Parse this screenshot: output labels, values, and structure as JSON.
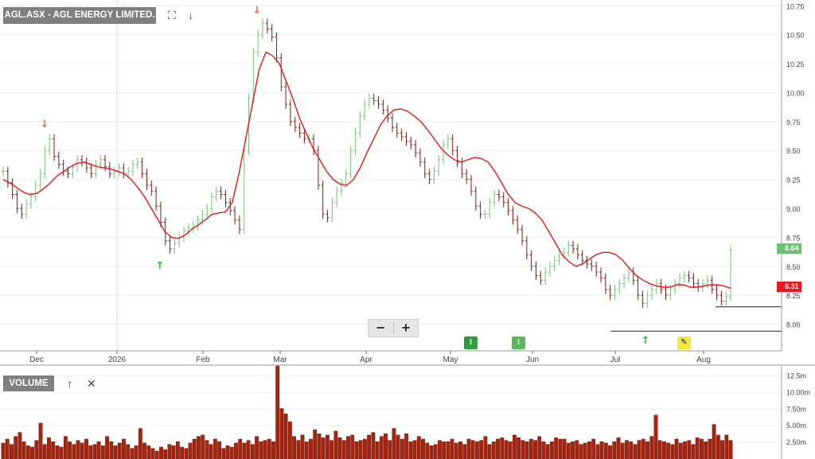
{
  "chart_title": "AGL.ASX - AGL ENERGY LIMITED.",
  "volume_label": "VOLUME",
  "icons": {
    "fullscreen": "fullscreen-icon",
    "download": "arrow-down-icon",
    "volume_up": "arrow-up-icon",
    "volume_close": "close-icon",
    "zoom_out": "minus-icon",
    "zoom_in": "plus-icon",
    "drawing": "pencil-icon"
  },
  "zoom": {
    "minus": "−",
    "plus": "+"
  },
  "event_markers": [
    {
      "label": "I",
      "color": "#2e9e3a"
    },
    {
      "label": "I",
      "color": "#5cb85c"
    }
  ],
  "price_tags": {
    "last": {
      "label": "8.64",
      "color": "#6fbf73"
    },
    "ma": {
      "label": "8.31",
      "color": "#e8191c"
    }
  },
  "colors": {
    "up_bar": "#7fbf7f",
    "down_bar": "#7a1e1e",
    "ma_line": "#e8191c",
    "volume_bar": "#a8240e",
    "signal_up": "#23c323",
    "signal_down": "#e07070"
  },
  "chart_data": [
    {
      "type": "line",
      "subtype": "ohlc-with-moving-average",
      "x_ticks": [
        "Dec",
        "2026",
        "Feb",
        "Mar",
        "Apr",
        "May",
        "Jun",
        "Jul",
        "Aug"
      ],
      "y_ticks": [
        "10.75",
        "10.50",
        "10.25",
        "10.00",
        "9.75",
        "9.50",
        "9.25",
        "9.00",
        "8.75",
        "8.50",
        "8.25",
        "8.00"
      ],
      "ylim": [
        7.77,
        10.8
      ],
      "support_lines": [
        7.94,
        8.15
      ],
      "grid": true,
      "close_series": [
        9.32,
        9.22,
        9.12,
        9.0,
        8.95,
        9.04,
        9.1,
        9.2,
        9.3,
        9.5,
        9.6,
        9.45,
        9.38,
        9.32,
        9.3,
        9.35,
        9.42,
        9.4,
        9.35,
        9.3,
        9.38,
        9.42,
        9.36,
        9.3,
        9.32,
        9.35,
        9.3,
        9.32,
        9.38,
        9.4,
        9.3,
        9.2,
        9.15,
        9.02,
        8.88,
        8.72,
        8.65,
        8.7,
        8.75,
        8.8,
        8.83,
        8.85,
        8.9,
        8.95,
        9.0,
        9.1,
        9.15,
        9.12,
        9.05,
        8.98,
        8.9,
        8.82,
        9.5,
        9.95,
        10.35,
        10.5,
        10.6,
        10.55,
        10.48,
        10.3,
        10.05,
        9.9,
        9.75,
        9.7,
        9.65,
        9.6,
        9.6,
        9.5,
        9.2,
        8.95,
        8.92,
        9.05,
        9.15,
        9.22,
        9.3,
        9.5,
        9.65,
        9.8,
        9.9,
        9.95,
        9.93,
        9.9,
        9.85,
        9.78,
        9.7,
        9.65,
        9.62,
        9.58,
        9.55,
        9.48,
        9.4,
        9.3,
        9.25,
        9.32,
        9.42,
        9.55,
        9.6,
        9.5,
        9.4,
        9.3,
        9.25,
        9.15,
        9.02,
        8.95,
        8.95,
        9.05,
        9.12,
        9.1,
        9.05,
        8.98,
        8.9,
        8.82,
        8.72,
        8.6,
        8.5,
        8.42,
        8.38,
        8.45,
        8.5,
        8.55,
        8.6,
        8.62,
        8.68,
        8.65,
        8.6,
        8.55,
        8.52,
        8.5,
        8.45,
        8.4,
        8.3,
        8.25,
        8.3,
        8.35,
        8.4,
        8.45,
        8.38,
        8.25,
        8.18,
        8.25,
        8.3,
        8.35,
        8.3,
        8.25,
        8.3,
        8.35,
        8.4,
        8.42,
        8.4,
        8.35,
        8.32,
        8.35,
        8.38,
        8.3,
        8.25,
        8.2,
        8.24,
        8.64
      ],
      "ma_series": [
        9.25,
        9.22,
        9.18,
        9.14,
        9.12,
        9.13,
        9.17,
        9.22,
        9.28,
        9.32,
        9.36,
        9.39,
        9.4,
        9.38,
        9.36,
        9.35,
        9.34,
        9.32,
        9.3,
        9.25,
        9.18,
        9.1,
        9.0,
        8.9,
        8.8,
        8.75,
        8.74,
        8.77,
        8.82,
        8.86,
        8.9,
        8.95,
        8.96,
        8.97,
        9.05,
        9.3,
        9.6,
        9.9,
        10.2,
        10.35,
        10.32,
        10.25,
        10.1,
        9.95,
        9.78,
        9.65,
        9.52,
        9.42,
        9.32,
        9.25,
        9.21,
        9.2,
        9.25,
        9.35,
        9.48,
        9.6,
        9.72,
        9.8,
        9.85,
        9.86,
        9.84,
        9.8,
        9.75,
        9.68,
        9.6,
        9.52,
        9.46,
        9.42,
        9.4,
        9.42,
        9.44,
        9.43,
        9.4,
        9.32,
        9.22,
        9.12,
        9.05,
        9.02,
        9.0,
        8.96,
        8.9,
        8.8,
        8.7,
        8.6,
        8.54,
        8.5,
        8.52,
        8.56,
        8.6,
        8.62,
        8.62,
        8.6,
        8.55,
        8.48,
        8.42,
        8.38,
        8.35,
        8.33,
        8.32,
        8.32,
        8.34,
        8.34,
        8.32,
        8.32,
        8.33,
        8.34,
        8.34,
        8.33,
        8.31
      ],
      "signal_up_x": [
        36,
        115,
        288
      ],
      "signal_down_x": [
        10,
        110
      ],
      "open_volume": "expressed in volume_values"
    },
    {
      "type": "bar",
      "title": "",
      "y_ticks": [
        "12.5m",
        "10.00m",
        "7.50m",
        "5.00m",
        "2.50m"
      ],
      "ylim": [
        0,
        14
      ],
      "volume_values": [
        2.4,
        3.0,
        2.2,
        3.4,
        4.0,
        2.6,
        2.0,
        1.8,
        2.8,
        5.4,
        2.2,
        3.2,
        2.6,
        2.0,
        1.8,
        3.4,
        2.6,
        2.2,
        2.8,
        2.4,
        3.0,
        2.0,
        2.2,
        2.6,
        2.0,
        3.4,
        2.6,
        2.0,
        2.4,
        3.0,
        2.2,
        1.6,
        2.0,
        4.6,
        2.4,
        2.0,
        1.6,
        1.2,
        1.8,
        1.4,
        2.2,
        2.0,
        2.6,
        1.8,
        1.6,
        2.4,
        3.0,
        3.4,
        3.6,
        2.8,
        2.2,
        3.0,
        2.6,
        1.6,
        2.0,
        1.8,
        2.4,
        3.0,
        2.4,
        2.8,
        2.2,
        3.4,
        2.6,
        2.8,
        3.0,
        2.6,
        14.0,
        7.6,
        6.8,
        5.6,
        3.4,
        2.8,
        3.6,
        2.6,
        3.0,
        4.4,
        3.8,
        3.2,
        3.6,
        2.8,
        4.2,
        3.2,
        2.8,
        3.4,
        3.6,
        2.6,
        2.8,
        3.0,
        3.6,
        4.0,
        2.6,
        3.4,
        3.8,
        2.8,
        4.6,
        3.6,
        3.0,
        3.8,
        2.6,
        2.8,
        3.4,
        3.0,
        2.4,
        2.0,
        2.2,
        2.8,
        2.6,
        2.6,
        3.0,
        2.4,
        2.6,
        2.2,
        3.0,
        2.8,
        2.6,
        2.8,
        3.4,
        2.2,
        2.6,
        3.0,
        3.2,
        2.8,
        2.6,
        3.6,
        3.2,
        2.8,
        2.6,
        3.0,
        2.8,
        3.4,
        2.6,
        2.2,
        2.6,
        3.2,
        3.0,
        3.0,
        2.4,
        2.6,
        2.8,
        2.2,
        2.4,
        2.6,
        3.0,
        2.2,
        2.6,
        2.4,
        2.0,
        2.6,
        3.2,
        2.4,
        2.8,
        2.6,
        2.2,
        2.8,
        3.0,
        2.6,
        3.4,
        6.6,
        2.8,
        2.6,
        2.4,
        2.2,
        3.0,
        2.4,
        2.6,
        2.8,
        2.2,
        3.2,
        3.0,
        2.6,
        3.0,
        5.2,
        3.6,
        2.8,
        3.6,
        2.8
      ]
    }
  ]
}
